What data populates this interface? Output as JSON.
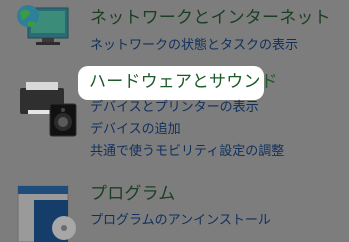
{
  "sections": {
    "network": {
      "title": "ネットワークとインターネット",
      "links": [
        "ネットワークの状態とタスクの表示"
      ],
      "icon": "network-globe-icon"
    },
    "hardware": {
      "title": "ハードウェアとサウンド",
      "links": [
        "デバイスとプリンターの表示",
        "デバイスの追加",
        "共通で使うモビリティ設定の調整"
      ],
      "icon": "printer-speaker-icon"
    },
    "programs": {
      "title": "プログラム",
      "links": [
        "プログラムのアンインストール"
      ],
      "icon": "program-disc-icon"
    }
  },
  "colors": {
    "overlay": "#7d7d7d",
    "heading": "#1b3f22",
    "link": "#10305c",
    "highlight": "#ffffff"
  }
}
